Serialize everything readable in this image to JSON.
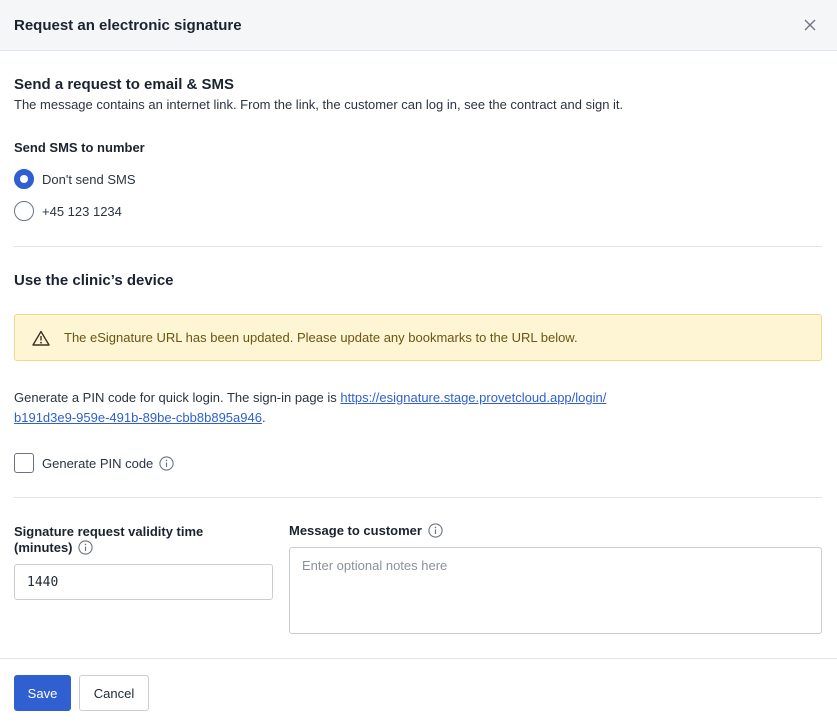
{
  "dialog": {
    "title": "Request an electronic signature"
  },
  "email_sms": {
    "title": "Send a request to email & SMS",
    "description": "The message contains an internet link. From the link, the customer can log in, see the contract and sign it.",
    "sms_label": "Send SMS to number",
    "options": [
      {
        "label": "Don't send SMS",
        "checked": true
      },
      {
        "label": "+45 123 1234",
        "checked": false
      }
    ]
  },
  "clinic_device": {
    "title": "Use the clinic’s device",
    "alert": "The eSignature URL has been updated. Please update any bookmarks to the URL below.",
    "pin_text_prefix": "Generate a PIN code for quick login. The sign-in page is ",
    "pin_link_line1": "https://esignature.stage.provetcloud.app/login/",
    "pin_link_line2": "b191d3e9-959e-491b-89be-cbb8b895a946",
    "pin_text_suffix": ".",
    "pin_checkbox_label": "Generate PIN code"
  },
  "validity": {
    "label_line1": "Signature request validity time",
    "label_line2": "(minutes)",
    "value": "1440"
  },
  "message": {
    "label": "Message to customer",
    "placeholder": "Enter optional notes here"
  },
  "footer": {
    "save_label": "Save",
    "cancel_label": "Cancel"
  },
  "colors": {
    "primary": "#2f5fd0",
    "alert_bg": "#fdf5d3",
    "alert_text": "#6b5612"
  }
}
